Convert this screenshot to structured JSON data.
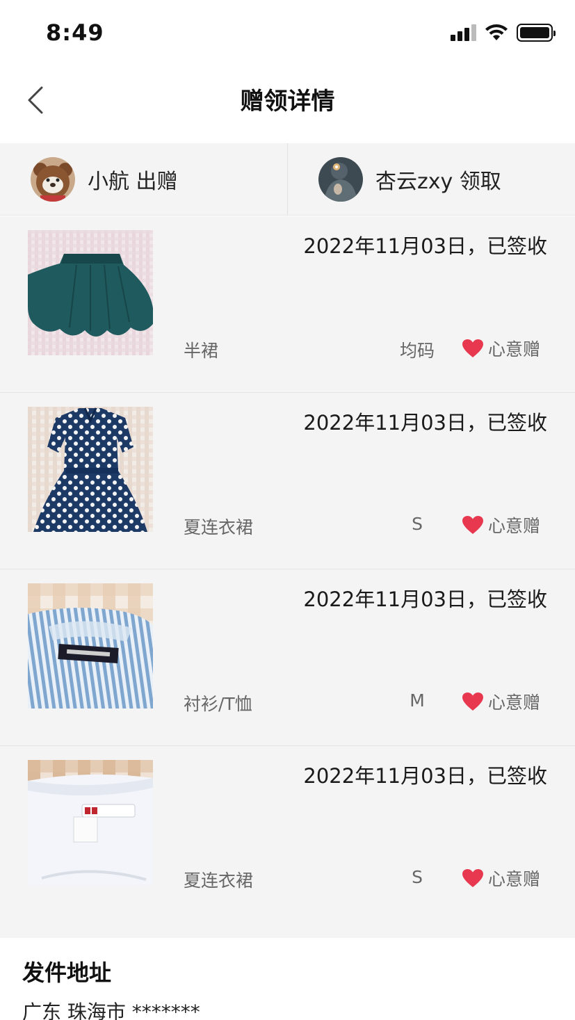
{
  "status_bar": {
    "time": "8:49"
  },
  "nav": {
    "title": "赠领详情"
  },
  "parties": {
    "giver": {
      "name": "小航 出赠"
    },
    "receiver": {
      "name": "杏云zxy 领取"
    }
  },
  "items": [
    {
      "date": "2022年11月03日，已签收",
      "name": "半裙",
      "size": "均码",
      "gift_label": "心意赠"
    },
    {
      "date": "2022年11月03日，已签收",
      "name": "夏连衣裙",
      "size": "S",
      "gift_label": "心意赠"
    },
    {
      "date": "2022年11月03日，已签收",
      "name": "衬衫/T恤",
      "size": "M",
      "gift_label": "心意赠"
    },
    {
      "date": "2022年11月03日，已签收",
      "name": "夏连衣裙",
      "size": "S",
      "gift_label": "心意赠"
    }
  ],
  "address": {
    "title": "发件地址",
    "text": "广东 珠海市 *******"
  },
  "colors": {
    "heart": "#e8384f",
    "background": "#f4f4f4"
  }
}
